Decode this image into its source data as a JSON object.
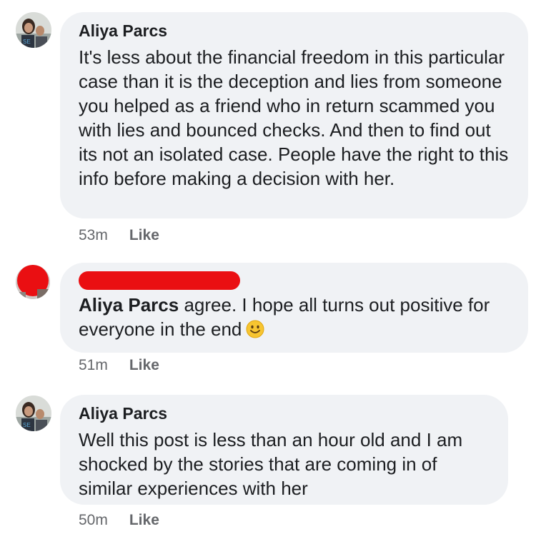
{
  "comments": [
    {
      "author": "Aliya Parcs",
      "text": "It's less about the financial freedom in this particular case than it is the deception and lies from someone you helped as a friend who in return scammed you with lies and bounced checks. And then to find out its not an isolated case. People have the right to this info before making a decision with her.",
      "time": "53m",
      "like_label": "Like"
    },
    {
      "author": "",
      "author_redacted": true,
      "reply_to": "Aliya Parcs",
      "text": "agree. I hope all turns out positive for everyone in the end",
      "emoji": "smiling-face",
      "time": "51m",
      "like_label": "Like"
    },
    {
      "author": "Aliya Parcs",
      "text": "Well this post is less than an hour old and I am shocked by the stories that are coming in of similar experiences with her",
      "time": "50m",
      "like_label": "Like"
    }
  ],
  "colors": {
    "bubble": "#f0f2f5",
    "text": "#1c1e21",
    "meta": "#65676b",
    "redaction": "#ea0f12"
  }
}
